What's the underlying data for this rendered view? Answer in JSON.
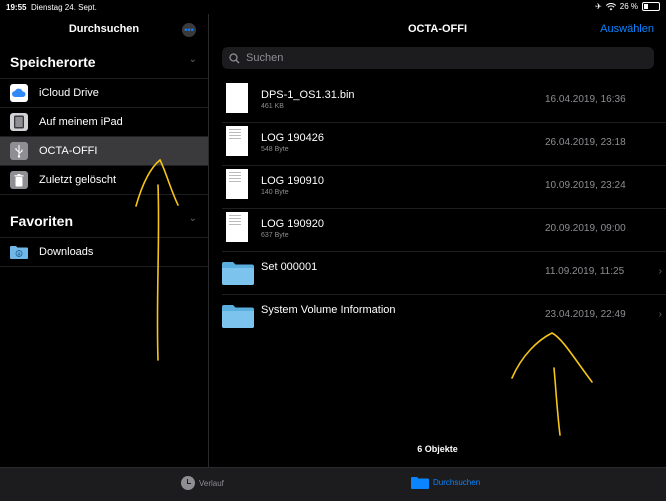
{
  "status_bar": {
    "time": "19:55",
    "date": "Dienstag 24. Sept.",
    "battery": "26 %",
    "battery_level": 0.26
  },
  "sidebar": {
    "title": "Durchsuchen",
    "more_icon": "ellipsis-icon",
    "sections": [
      {
        "title": "Speicherorte",
        "items": [
          {
            "label": "iCloud Drive",
            "icon": "icloud-icon"
          },
          {
            "label": "Auf meinem iPad",
            "icon": "ipad-icon"
          },
          {
            "label": "OCTA-OFFI",
            "icon": "usb-icon",
            "selected": true
          },
          {
            "label": "Zuletzt gelöscht",
            "icon": "trash-icon"
          }
        ]
      },
      {
        "title": "Favoriten",
        "items": [
          {
            "label": "Downloads",
            "icon": "folder-download-icon"
          }
        ]
      }
    ]
  },
  "main": {
    "title": "OCTA-OFFI",
    "select_label": "Auswählen",
    "search_placeholder": "Suchen",
    "files": [
      {
        "name": "DPS-1_OS1.31.bin",
        "size": "461 KB",
        "date": "16.04.2019, 16:36",
        "kind": "file"
      },
      {
        "name": "LOG 190426",
        "size": "548 Byte",
        "date": "26.04.2019, 23:18",
        "kind": "doc"
      },
      {
        "name": "LOG 190910",
        "size": "140 Byte",
        "date": "10.09.2019, 23:24",
        "kind": "doc"
      },
      {
        "name": "LOG 190920",
        "size": "637 Byte",
        "date": "20.09.2019, 09:00",
        "kind": "doc"
      },
      {
        "name": "Set 000001",
        "size": "",
        "date": "11.09.2019, 11:25",
        "kind": "folder"
      },
      {
        "name": "System Volume Information",
        "size": "",
        "date": "23.04.2019, 22:49",
        "kind": "folder"
      }
    ],
    "count_label": "6 Objekte"
  },
  "tab_bar": {
    "recents": {
      "label": "Verlauf",
      "icon": "clock-icon"
    },
    "browse": {
      "label": "Durchsuchen",
      "icon": "folder-icon"
    }
  },
  "colors": {
    "accent": "#0a84ff",
    "annotation": "#f5c518"
  }
}
